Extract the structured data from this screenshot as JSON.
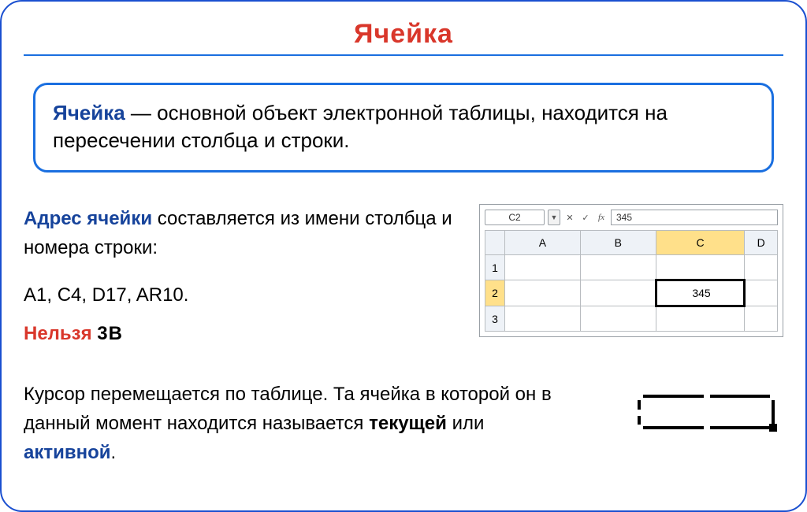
{
  "title": "Ячейка",
  "definition": {
    "term": "Ячейка",
    "rest": " — основной объект электронной таблицы, находится на пересечении столбца и строки."
  },
  "address": {
    "term": "Адрес ячейки",
    "rest": " составляется из имени столбца и номера строки:",
    "examples": "A1, C4, D17, AR10.",
    "warn": "Нельзя",
    "warn_code": "3B"
  },
  "sheet": {
    "namebox": "C2",
    "fvalue": "345",
    "columns": [
      "A",
      "B",
      "C",
      "D"
    ],
    "rows": [
      "1",
      "2",
      "3"
    ],
    "active_col_index": 2,
    "active_row_index": 1,
    "active_value": "345",
    "icons": {
      "dropdown": "▼",
      "cancel": "✕",
      "confirm": "✓",
      "fx": "fx"
    }
  },
  "cursor": {
    "p1": "Курсор перемещается по таблице. Та ячейка в которой он в данный момент находится называется ",
    "w_current": "текущей",
    "or": " или ",
    "w_active": "активной",
    "dot": "."
  }
}
